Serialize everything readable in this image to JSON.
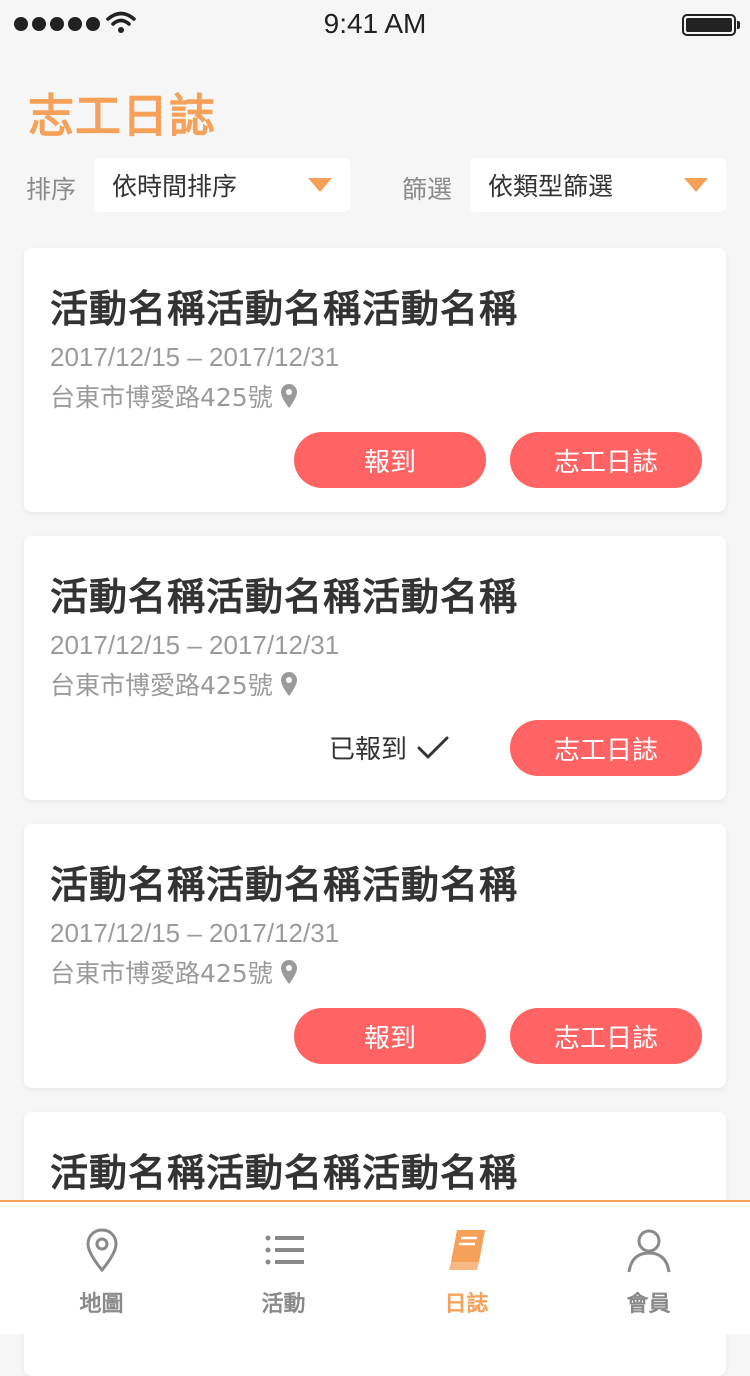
{
  "status_bar": {
    "time": "9:41 AM"
  },
  "header": {
    "title": "志工日誌"
  },
  "filters": {
    "sort_label": "排序",
    "sort_value": "依時間排序",
    "filter_label": "篩選",
    "filter_value": "依類型篩選"
  },
  "cards": [
    {
      "title": "活動名稱活動名稱活動名稱",
      "date": "2017/12/15 – 2017/12/31",
      "address": "台東市博愛路425號",
      "checkin_label": "報到",
      "diary_label": "志工日誌"
    },
    {
      "title": "活動名稱活動名稱活動名稱",
      "date": "2017/12/15 – 2017/12/31",
      "address": "台東市博愛路425號",
      "checked_label": "已報到",
      "diary_label": "志工日誌"
    },
    {
      "title": "活動名稱活動名稱活動名稱",
      "date": "2017/12/15 – 2017/12/31",
      "address": "台東市博愛路425號",
      "checkin_label": "報到",
      "diary_label": "志工日誌"
    },
    {
      "title": "活動名稱活動名稱活動名稱"
    }
  ],
  "tab_bar": {
    "tabs": [
      {
        "label": "地圖",
        "icon": "map-pin-icon"
      },
      {
        "label": "活動",
        "icon": "list-icon"
      },
      {
        "label": "日誌",
        "icon": "book-icon",
        "active": true
      },
      {
        "label": "會員",
        "icon": "user-icon"
      }
    ]
  },
  "colors": {
    "accent": "#f5a15a",
    "button": "#ff6363",
    "background": "#f6f6f6"
  }
}
